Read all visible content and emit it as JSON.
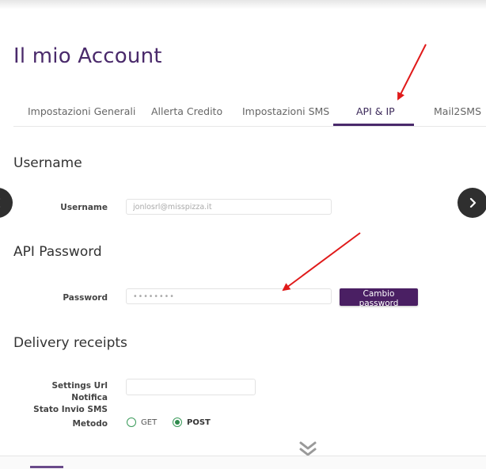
{
  "page": {
    "title": "Il mio Account"
  },
  "tabs": [
    {
      "label": "Impostazioni Generali",
      "active": false
    },
    {
      "label": "Allerta Credito",
      "active": false
    },
    {
      "label": "Impostazioni SMS",
      "active": false
    },
    {
      "label": "API & IP",
      "active": true
    },
    {
      "label": "Mail2SMS",
      "active": false
    }
  ],
  "username_section": {
    "title": "Username",
    "label": "Username",
    "value": "jonlosrl@misspizza.it"
  },
  "password_section": {
    "title": "API Password",
    "label": "Password",
    "value": "••••••••",
    "change_button": "Cambio password"
  },
  "delivery_section": {
    "title": "Delivery receipts",
    "url_label_line1": "Settings Url Notifica",
    "url_label_line2": "Stato Invio SMS",
    "url_value": "",
    "method_label": "Metodo",
    "methods": [
      {
        "label": "GET",
        "checked": false
      },
      {
        "label": "POST",
        "checked": true
      }
    ]
  },
  "colors": {
    "brand": "#4a2a6b",
    "button": "#4a1f63",
    "radio": "#2f8a4c",
    "annotation_arrow": "#e01a1a"
  },
  "icons": {
    "prev": "chevron-left-icon",
    "next": "chevron-right-icon",
    "scroll": "double-chevron-down-icon"
  }
}
